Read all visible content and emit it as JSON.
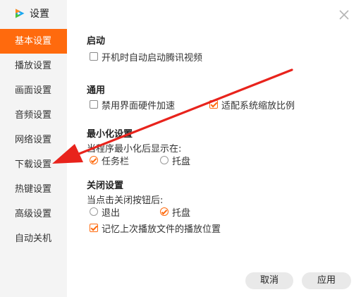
{
  "app": {
    "title": "设置",
    "logo_icon": "tencent-video-logo-icon"
  },
  "colors": {
    "accent": "#ff6a0d",
    "sidebar_bg": "#f4f4f4",
    "annotation_arrow": "#e8231c"
  },
  "sidebar": {
    "items": [
      {
        "label": "基本设置",
        "active": true
      },
      {
        "label": "播放设置"
      },
      {
        "label": "画面设置"
      },
      {
        "label": "音频设置"
      },
      {
        "label": "网络设置"
      },
      {
        "label": "下载设置"
      },
      {
        "label": "热键设置"
      },
      {
        "label": "高级设置"
      },
      {
        "label": "自动关机"
      }
    ]
  },
  "sections": {
    "startup": {
      "title": "启动",
      "options": [
        {
          "label": "开机时自动启动腾讯视频",
          "checked": false
        }
      ]
    },
    "general": {
      "title": "通用",
      "options": [
        {
          "label": "禁用界面硬件加速",
          "checked": false
        },
        {
          "label": "适配系统缩放比例",
          "checked": true
        }
      ]
    },
    "minimize": {
      "title": "最小化设置",
      "description": "当程序最小化后显示在:",
      "options": [
        {
          "label": "任务栏",
          "selected": true
        },
        {
          "label": "托盘",
          "selected": false
        }
      ]
    },
    "close": {
      "title": "关闭设置",
      "description": "当点击关闭按钮后:",
      "options": [
        {
          "label": "退出",
          "selected": false
        },
        {
          "label": "托盘",
          "selected": true
        }
      ],
      "remember": {
        "label": "记忆上次播放文件的播放位置",
        "checked": true
      }
    }
  },
  "footer": {
    "cancel_label": "取消",
    "apply_label": "应用"
  }
}
